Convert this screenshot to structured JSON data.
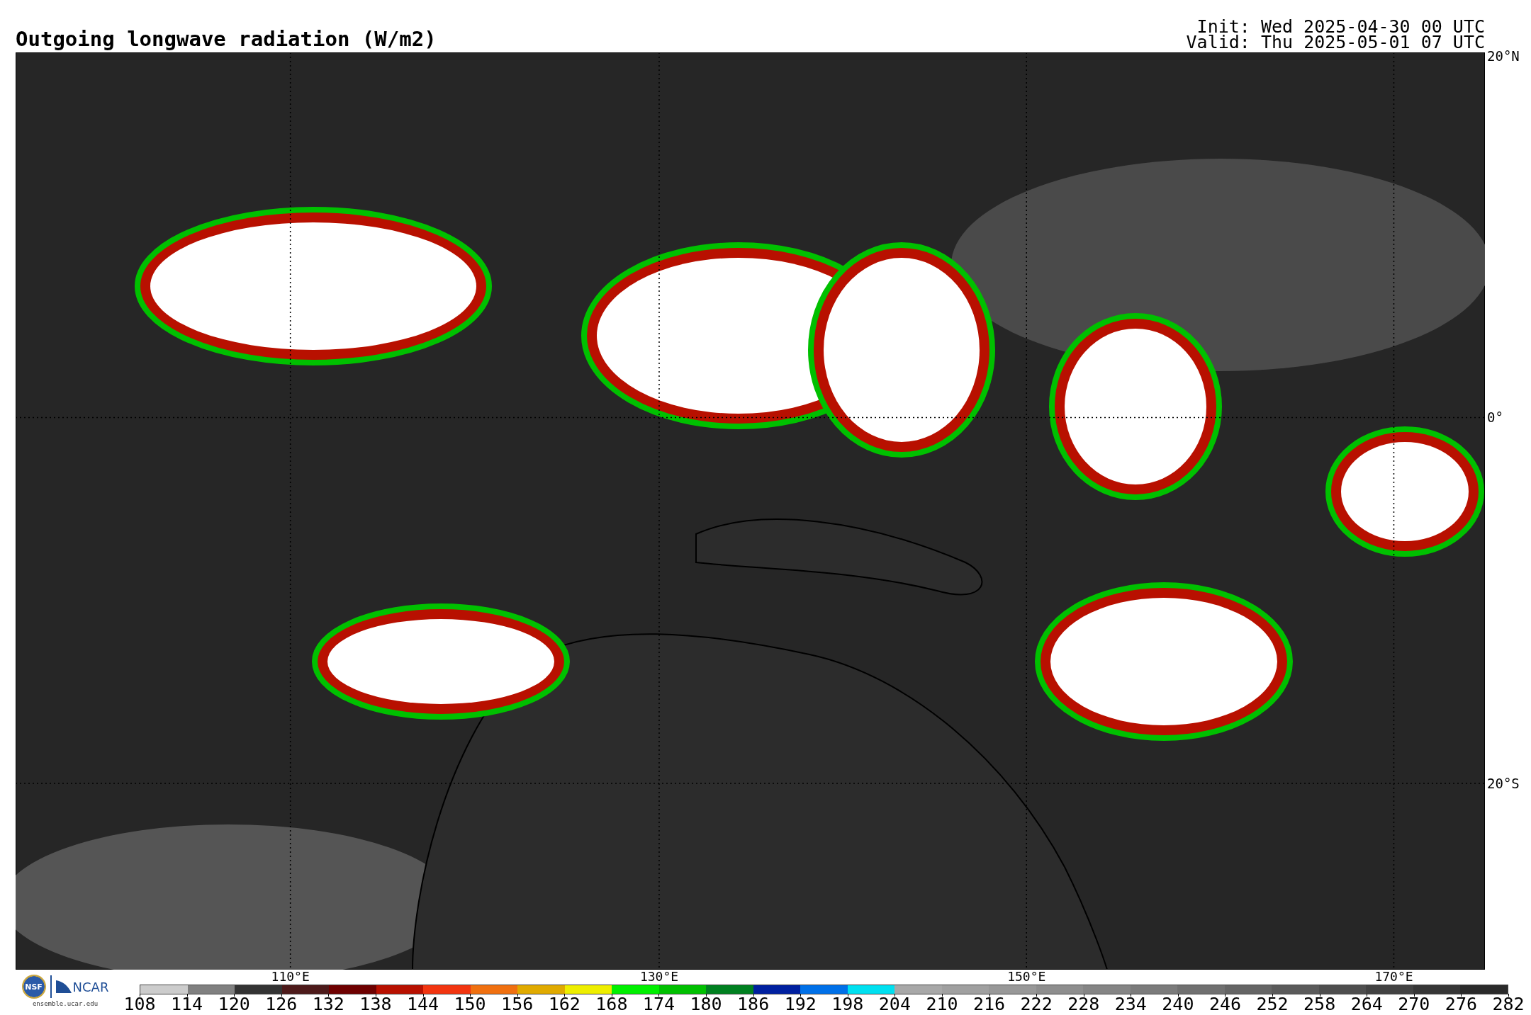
{
  "title": "Outgoing longwave radiation (W/m2)",
  "init": "Init: Wed 2025-04-30 00 UTC",
  "valid": "Valid: Thu 2025-05-01 07 UTC",
  "map": {
    "lat_labels": [
      "20°N",
      "0°",
      "20°S"
    ],
    "lon_labels": [
      "110°E",
      "130°E",
      "150°E",
      "170°E"
    ]
  },
  "logo": {
    "nsf": "NSF",
    "ncar": "NCAR",
    "site": "ensemble.ucar.edu"
  },
  "colorbar": {
    "ticks": [
      "108",
      "114",
      "120",
      "126",
      "132",
      "138",
      "144",
      "150",
      "156",
      "162",
      "168",
      "174",
      "180",
      "186",
      "192",
      "198",
      "204",
      "210",
      "216",
      "222",
      "228",
      "234",
      "240",
      "246",
      "252",
      "258",
      "264",
      "270",
      "276",
      "282"
    ],
    "segments": [
      {
        "color": "#cccccc"
      },
      {
        "color": "#808080"
      },
      {
        "color": "#333333"
      },
      {
        "color": "#4d1a1a"
      },
      {
        "color": "#6e0000"
      },
      {
        "color": "#b81000"
      },
      {
        "color": "#f23510"
      },
      {
        "color": "#f07010"
      },
      {
        "color": "#e0aa00"
      },
      {
        "color": "#eeee00"
      },
      {
        "color": "#00f000"
      },
      {
        "color": "#00c000"
      },
      {
        "color": "#008020"
      },
      {
        "color": "#0020a0"
      },
      {
        "color": "#0070e8"
      },
      {
        "color": "#00e0f0"
      },
      {
        "color": "#a8a8a8"
      },
      {
        "color": "#a0a0a0"
      },
      {
        "color": "#989898"
      },
      {
        "color": "#8e8e8e"
      },
      {
        "color": "#858585"
      },
      {
        "color": "#7b7b7b"
      },
      {
        "color": "#707070"
      },
      {
        "color": "#656565"
      },
      {
        "color": "#5a5a5a"
      },
      {
        "color": "#4e4e4e"
      },
      {
        "color": "#424242"
      },
      {
        "color": "#363636"
      },
      {
        "color": "#2a2a2a"
      }
    ]
  }
}
